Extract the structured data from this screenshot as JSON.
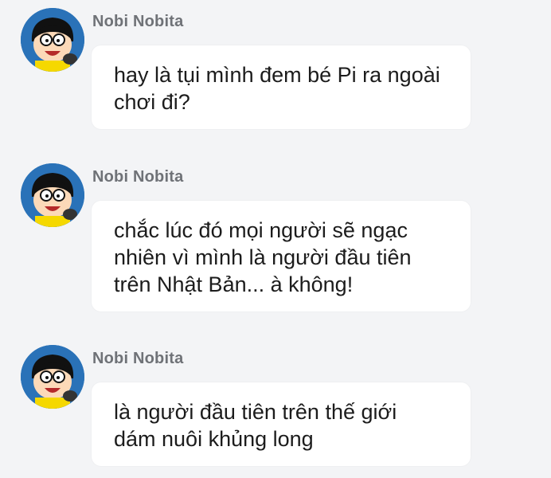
{
  "messages": [
    {
      "sender": "Nobi Nobita",
      "avatar_icon": "nobita-avatar",
      "text": "hay là tụi mình đem bé Pi ra ngoài\nchơi đi?"
    },
    {
      "sender": "Nobi Nobita",
      "avatar_icon": "nobita-avatar",
      "text": "chắc lúc đó mọi người sẽ ngạc\nnhiên vì mình là người đầu tiên\ntrên Nhật  Bản... à không!"
    },
    {
      "sender": "Nobi Nobita",
      "avatar_icon": "nobita-avatar",
      "text": "là người đầu tiên trên thế giới\ndám nuôi khủng long"
    }
  ],
  "colors": {
    "background": "#f3f4f6",
    "bubble": "#ffffff",
    "sender_text": "#6f7277",
    "message_text": "#1c1c1c"
  }
}
